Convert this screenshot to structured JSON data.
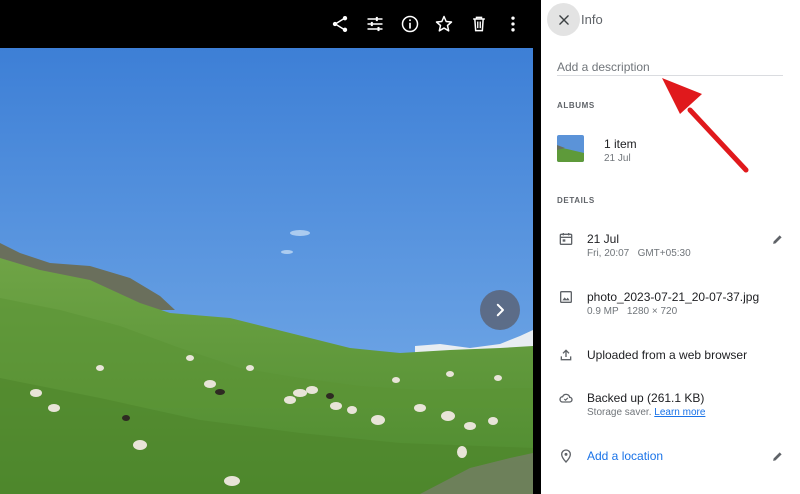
{
  "toolbar": {
    "icons": [
      "share-icon",
      "edit-sliders-icon",
      "info-icon",
      "star-icon",
      "trash-icon",
      "more-vert-icon"
    ]
  },
  "viewer": {
    "next_icon": "chevron-right-icon"
  },
  "panel": {
    "title": "Info",
    "description_placeholder": "Add a description",
    "albums": {
      "heading": "ALBUMS",
      "items": [
        {
          "count": "1 item",
          "date": "21 Jul"
        }
      ]
    },
    "details": {
      "heading": "DETAILS",
      "date": {
        "primary": "21 Jul",
        "secondary": "Fri, 20:07   GMT+05:30"
      },
      "file": {
        "name": "photo_2023-07-21_20-07-37.jpg",
        "meta": "0.9 MP   1280 × 720"
      },
      "upload": {
        "text": "Uploaded from a web browser"
      },
      "backup": {
        "primary": "Backed up (261.1 KB)",
        "secondary_prefix": "Storage saver.",
        "learn_more": "Learn more"
      },
      "location": {
        "text": "Add a location"
      }
    }
  },
  "colors": {
    "link": "#1a73e8",
    "arrow": "#e0191c",
    "sky": "#4f8fdb",
    "grass": "#5e9a3a"
  }
}
